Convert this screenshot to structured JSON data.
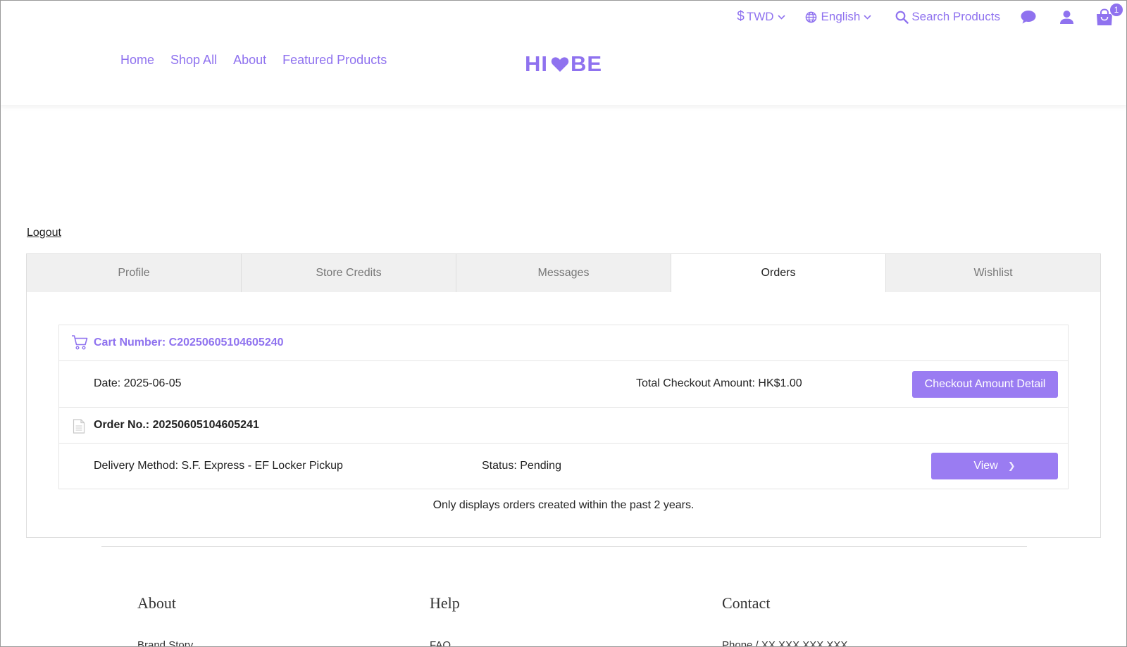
{
  "header": {
    "currency": "TWD",
    "language": "English",
    "search_label": "Search Products",
    "cart_count": "1",
    "nav": [
      "Home",
      "Shop All",
      "About",
      "Featured Products"
    ],
    "logo_left": "HI",
    "logo_right": "BE"
  },
  "account": {
    "logout": "Logout",
    "tabs": [
      "Profile",
      "Store Credits",
      "Messages",
      "Orders",
      "Wishlist"
    ],
    "active_tab": "Orders"
  },
  "order": {
    "cart_number": "Cart Number: C20250605104605240",
    "date": "Date: 2025-06-05",
    "total": "Total Checkout Amount: HK$1.00",
    "detail_button": "Checkout Amount Detail",
    "order_no": "Order No.: 20250605104605241",
    "delivery": "Delivery Method: S.F. Express - EF Locker Pickup",
    "status": "Status: Pending",
    "view_button": "View"
  },
  "note": "Only displays orders created within the past 2 years.",
  "footer": {
    "columns": [
      {
        "title": "About",
        "link": "Brand Story"
      },
      {
        "title": "Help",
        "link": "FAQ"
      },
      {
        "title": "Contact",
        "link": "Phone / XX XXX XXX XXX"
      }
    ]
  },
  "colors": {
    "accent": "#8f72ef",
    "button": "#9a7cf2"
  },
  "icons": [
    "dollar-icon",
    "chevron-down-icon",
    "globe-icon",
    "search-icon",
    "chat-icon",
    "user-icon",
    "shopping-bag-icon",
    "heart-icon",
    "cart-icon",
    "document-icon",
    "chevron-right-icon"
  ]
}
